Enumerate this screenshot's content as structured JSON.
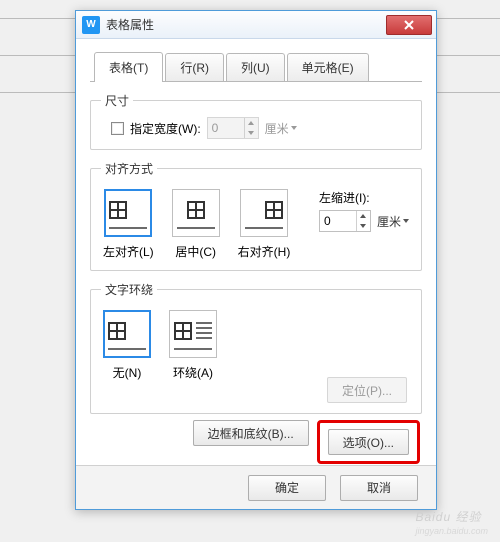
{
  "window": {
    "title": "表格属性",
    "app_icon_letter": "W"
  },
  "tabs": [
    {
      "label": "表格(T)",
      "active": true
    },
    {
      "label": "行(R)"
    },
    {
      "label": "列(U)"
    },
    {
      "label": "单元格(E)"
    }
  ],
  "size": {
    "legend": "尺寸",
    "width_label": "指定宽度(W):",
    "width_value": "0",
    "unit": "厘米"
  },
  "align": {
    "legend": "对齐方式",
    "options": [
      {
        "label": "左对齐(L)",
        "kind": "left",
        "selected": true
      },
      {
        "label": "居中(C)",
        "kind": "center"
      },
      {
        "label": "右对齐(H)",
        "kind": "right"
      }
    ],
    "indent_label": "左缩进(I):",
    "indent_value": "0",
    "indent_unit": "厘米"
  },
  "wrap": {
    "legend": "文字环绕",
    "options": [
      {
        "label": "无(N)",
        "kind": "left",
        "selected": true
      },
      {
        "label": "环绕(A)",
        "kind": "wrap"
      }
    ],
    "position_btn": "定位(P)..."
  },
  "buttons": {
    "border": "边框和底纹(B)...",
    "options": "选项(O)...",
    "ok": "确定",
    "cancel": "取消"
  },
  "watermark": {
    "main": "Baidu 经验",
    "sub": "jingyan.baidu.com"
  }
}
